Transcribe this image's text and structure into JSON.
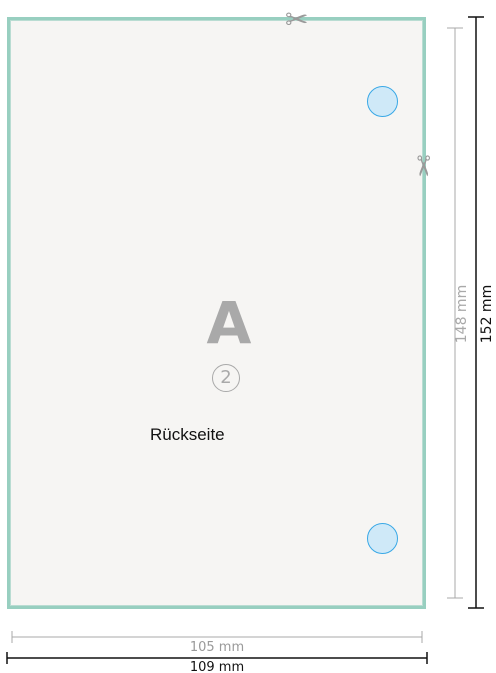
{
  "diagram": {
    "letter": "A",
    "number_symbol": "②",
    "side_label": "Rückseite",
    "scissors_icon": "✂",
    "dimensions": {
      "inner_width": "105 mm",
      "outer_width": "109 mm",
      "inner_height": "148 mm",
      "outer_height": "152 mm"
    },
    "colors": {
      "sheet_border": "#98cfc0",
      "sheet_fill": "#f6f5f3",
      "hole_fill": "#cfe9f8",
      "hole_border": "#39a8e6",
      "inner_dimension": "#a9a9a9",
      "outer_dimension": "#111111"
    }
  }
}
